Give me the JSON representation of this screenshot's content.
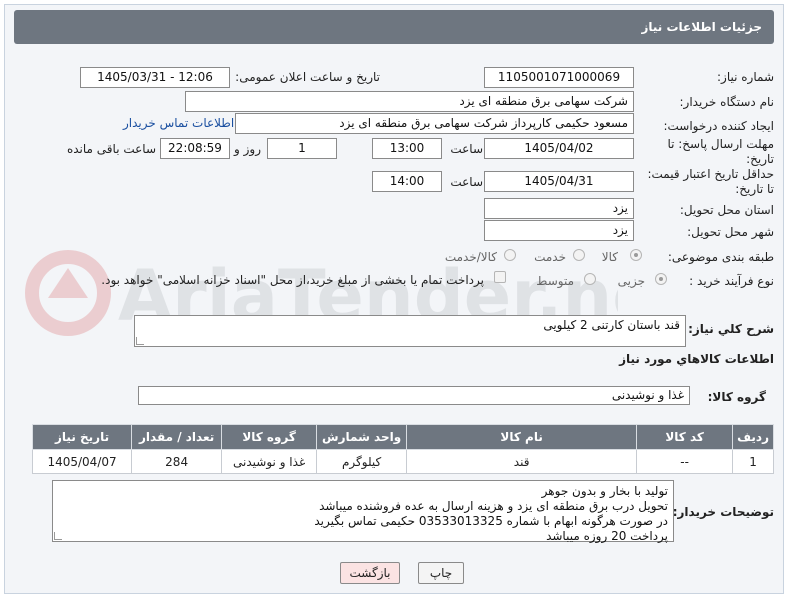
{
  "header": {
    "title": "جزئیات اطلاعات نیاز"
  },
  "form": {
    "need_number_label": "شماره نیاز:",
    "need_number": "1105001071000069",
    "announce_datetime_label": "تاریخ و ساعت اعلان عمومی:",
    "announce_datetime": "1405/03/31 - 12:06",
    "buyer_org_label": "نام دستگاه خریدار:",
    "buyer_org": "شرکت سهامی برق منطقه ای یزد",
    "creator_label": "ایجاد کننده درخواست:",
    "creator": "مسعود حکیمی کارپرداز شرکت سهامی برق منطقه ای یزد",
    "contact_link": "اطلاعات تماس خریدار",
    "reply_deadline_label_1": "مهلت ارسال پاسخ: تا",
    "reply_deadline_label_2": "تاریخ:",
    "reply_date": "1405/04/02",
    "time_label": "ساعت",
    "reply_time": "13:00",
    "days_value": "1",
    "days_label": "روز و",
    "remaining_time": "22:08:59",
    "remaining_label": "ساعت باقی مانده",
    "price_validity_label_1": "حداقل تاریخ اعتبار قیمت:",
    "price_validity_label_2": "تا تاریخ:",
    "price_validity_date": "1405/04/31",
    "price_validity_time": "14:00",
    "delivery_province_label": "استان محل تحویل:",
    "delivery_province": "یزد",
    "delivery_city_label": "شهر محل تحویل:",
    "delivery_city": "یزد",
    "category_label": "طبقه بندی موضوعی:",
    "category_options": [
      "کالا",
      "خدمت",
      "کالا/خدمت"
    ],
    "process_label": "نوع فرآیند خرید :",
    "process_options": [
      "جزیی",
      "متوسط"
    ],
    "payment_note": "پرداخت تمام یا بخشی از مبلغ خرید،از محل \"اسناد خزانه اسلامی\" خواهد بود.",
    "general_desc_label": "شرح کلي نیاز:",
    "general_desc": "قند باستان کارتنی 2 کیلویی",
    "goods_info_title": "اطلاعات کالاهاي مورد نیاز",
    "goods_group_label": "گروه کالا:",
    "goods_group": "غذا و نوشیدنی"
  },
  "table": {
    "headers": [
      "ردیف",
      "کد کالا",
      "نام کالا",
      "واحد شمارش",
      "گروه کالا",
      "تعداد / مقدار",
      "تاریخ نیاز"
    ],
    "rows": [
      [
        "1",
        "--",
        "قند",
        "کیلوگرم",
        "غذا و نوشیدنی",
        "284",
        "1405/04/07"
      ]
    ]
  },
  "buyer_notes": {
    "label": "توضیحات خریدار:",
    "lines": [
      "تولید با بخار و بدون جوهر",
      "تحویل درب برق منطقه ای یزد و هزینه ارسال به عده فروشنده میباشد",
      "در صورت هرگونه ابهام با شماره 03533013325 حکیمی تماس بگیرید",
      "پرداخت 20 روزه میباشد"
    ]
  },
  "buttons": {
    "print": "چاپ",
    "back": "بازگشت"
  },
  "watermark": {
    "text": "AriaTender.neT"
  },
  "colors": {
    "header_bg": "#6e7680",
    "link": "#1a4fa0",
    "back_btn_bg": "#fbe3e3"
  }
}
